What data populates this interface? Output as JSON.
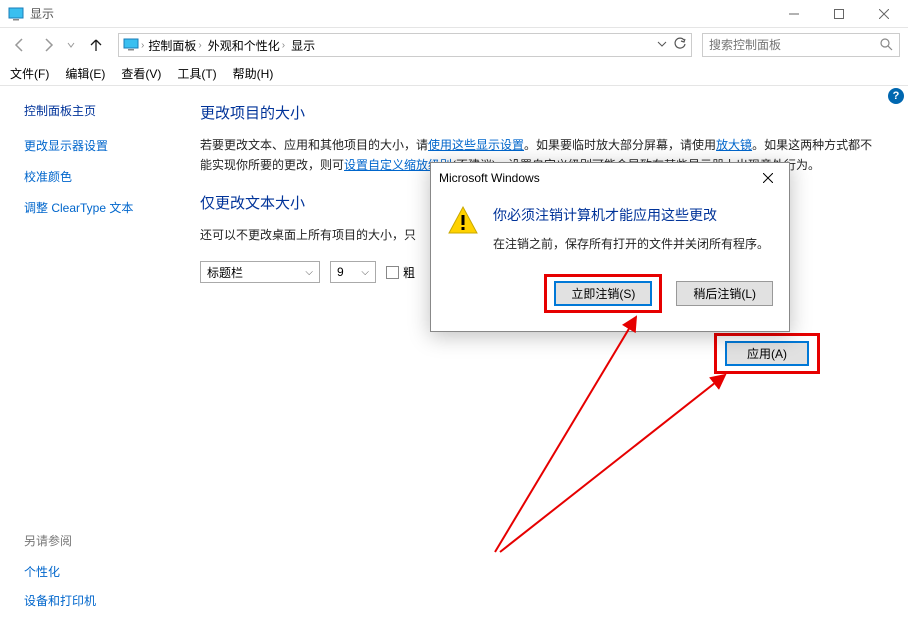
{
  "titlebar": {
    "title": "显示"
  },
  "nav": {
    "crumbs": [
      "控制面板",
      "外观和个性化",
      "显示"
    ],
    "search_placeholder": "搜索控制面板"
  },
  "menubar": [
    "文件(F)",
    "编辑(E)",
    "查看(V)",
    "工具(T)",
    "帮助(H)"
  ],
  "sidebar": {
    "home": "控制面板主页",
    "links": [
      "更改显示器设置",
      "校准颜色",
      "调整 ClearType 文本"
    ]
  },
  "main": {
    "heading1": "更改项目的大小",
    "para1_a": "若要更改文本、应用和其他项目的大小，请",
    "para1_link1": "使用这些显示设置",
    "para1_b": "。如果要临时放大部分屏幕，请使用",
    "para1_link2": "放大镜",
    "para1_c": "。如果这两种方式都不能实现你所要的更改，则可",
    "para1_link3": "设置自定义缩放级别",
    "para1_d": "(不建议)。设置自定义级别可能会导致在某些显示器上出现意外行为。",
    "heading2": "仅更改文本大小",
    "para2": "还可以不更改桌面上所有项目的大小，只",
    "dropdown1": "标题栏",
    "dropdown2": "9",
    "bold_label": "粗",
    "apply": "应用(A)"
  },
  "dialog": {
    "title": "Microsoft Windows",
    "heading": "你必须注销计算机才能应用这些更改",
    "text": "在注销之前，保存所有打开的文件并关闭所有程序。",
    "btn_logoff": "立即注销(S)",
    "btn_later": "稍后注销(L)"
  },
  "seealso": {
    "title": "另请参阅",
    "links": [
      "个性化",
      "设备和打印机"
    ]
  }
}
